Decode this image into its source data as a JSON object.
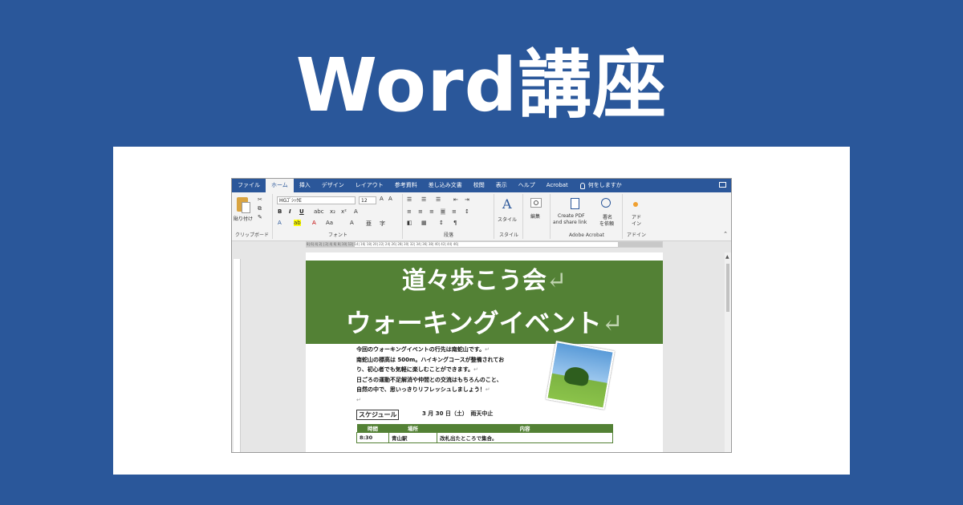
{
  "banner": {
    "title": "Word講座"
  },
  "word": {
    "tabs": [
      "ファイル",
      "ホーム",
      "挿入",
      "デザイン",
      "レイアウト",
      "参考資料",
      "差し込み文書",
      "校閲",
      "表示",
      "ヘルプ",
      "Acrobat"
    ],
    "active_tab": "ホーム",
    "tell_me": "何をしますか",
    "ribbon": {
      "paste": "貼り付け",
      "clipboard": "クリップボード",
      "font_name": "HGｺﾞｼｯｸE",
      "font_size": "12",
      "font_group": "フォント",
      "paragraph_group": "段落",
      "styles_btn": "スタイル",
      "styles_group": "スタイル",
      "edit_btn": "編集",
      "create_pdf_1": "Create PDF",
      "create_pdf_2": "and share link",
      "sign_1": "署名",
      "sign_2": "を依頼",
      "acrobat_group": "Adobe Acrobat",
      "addin_1": "アド",
      "addin_2": "イン",
      "addin_group": "アドイン",
      "bold": "B",
      "italic": "I",
      "underline": "U"
    },
    "ruler_text": "8| 6| 4| 2| | 2| 4| 6| 8| 10| 12| 14| 16| 18| 20| 22| 24| 26| 28| 30| 32| 34| 36| 38| 40| 42| 44| 46|",
    "document": {
      "heading1": "道々歩こう会",
      "heading2": "ウォーキングイベント",
      "return_mark": "↵",
      "lines": [
        "今回のウォーキングイベントの行先は南蛇山です。",
        "南蛇山の標高は 500m。ハイキングコースが整備されてお",
        "り、初心者でも気軽に楽しむことができます。",
        "日ごろの運動不足解消や仲間との交流はもちろんのこと、",
        "自然の中で、思いっきりリフレッシュしましょう！"
      ],
      "schedule_label": "スケジュール",
      "date": "3 月 30 日（土）　雨天中止",
      "table": {
        "headers": [
          "時間",
          "場所",
          "内容"
        ],
        "rows": [
          [
            "8:30",
            "青山駅",
            "改札出たところで集合。"
          ]
        ]
      }
    }
  }
}
